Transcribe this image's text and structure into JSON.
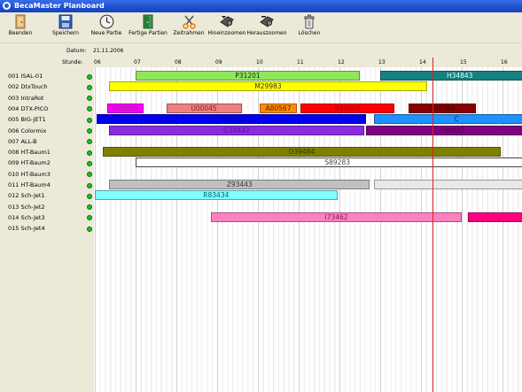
{
  "window": {
    "title": "BecaMaster Planboard"
  },
  "toolbar": {
    "buttons": [
      {
        "label": "Beenden"
      },
      {
        "label": "Speichern"
      },
      {
        "label": "Neue Partie"
      },
      {
        "label": "Fertige Partien"
      },
      {
        "label": "Zeitrahmen"
      },
      {
        "label": "Hineinzoomen"
      },
      {
        "label": "Herauszoomen"
      },
      {
        "label": "Löschen"
      }
    ]
  },
  "header": {
    "datum_label": "Datum:",
    "datum_value": "21.11.2006",
    "stunde_label": "Stunde:",
    "hours": [
      "06",
      "07",
      "08",
      "09",
      "10",
      "11",
      "12",
      "13",
      "14",
      "15",
      "16"
    ]
  },
  "machines": [
    {
      "label": "001  ISAL-01"
    },
    {
      "label": "002  DtxTouch"
    },
    {
      "label": "003  IntraRot"
    },
    {
      "label": "004  DTX-PICO"
    },
    {
      "label": "005  BIG-JET1"
    },
    {
      "label": "006  Colormix"
    },
    {
      "label": "007  ALL-B"
    },
    {
      "label": "008  HT-Baum1"
    },
    {
      "label": "009  HT-Baum2"
    },
    {
      "label": "010  HT-Baum3"
    },
    {
      "label": "011  HT-Baum4"
    },
    {
      "label": "012  Sch-Jet1"
    },
    {
      "label": "013  Sch-Jet2"
    },
    {
      "label": "014  Sch-Jet3"
    },
    {
      "label": "015  Sch-Jet4"
    }
  ],
  "jobs": [
    {
      "id": "job-p31201",
      "label": "P31201",
      "row": 0,
      "start": 7.0,
      "end": 12.5,
      "color": "#8ee85a",
      "text_color": "#222222"
    },
    {
      "id": "job-h34843",
      "label": "H34843",
      "row": 0,
      "start": 13.0,
      "end": 16.9,
      "color": "#178080",
      "text_color": "#e0ffff"
    },
    {
      "id": "job-m29983",
      "label": "M29983",
      "row": 1,
      "start": 6.35,
      "end": 14.15,
      "color": "#ffff00",
      "text_color": "#333333"
    },
    {
      "id": "job-r00005",
      "label": "R00005",
      "row": 3,
      "start": 6.3,
      "end": 7.2,
      "color": "#ff00ff",
      "text_color": "#a0208a"
    },
    {
      "id": "job-u00045",
      "label": "U00045",
      "row": 3,
      "start": 7.75,
      "end": 9.6,
      "color": "#f08080",
      "text_color": "#882020"
    },
    {
      "id": "job-a80567",
      "label": "A80567",
      "row": 3,
      "start": 10.05,
      "end": 10.95,
      "color": "#ff8c00",
      "text_color": "#552200"
    },
    {
      "id": "job-r84008",
      "label": "R84008",
      "row": 3,
      "start": 11.05,
      "end": 13.35,
      "color": "#ff0000",
      "text_color": "#aa0000"
    },
    {
      "id": "job-a09089",
      "label": "A09089",
      "row": 3,
      "start": 13.7,
      "end": 15.35,
      "color": "#8b0000",
      "text_color": "#400000"
    },
    {
      "id": "job-v06213",
      "label": "V06213",
      "row": 4,
      "start": 6.05,
      "end": 12.65,
      "color": "#0000ee",
      "text_color": "#0000aa"
    },
    {
      "id": "job-c00000",
      "label": "C",
      "row": 4,
      "start": 12.85,
      "end": 16.9,
      "color": "#1e90ff",
      "text_color": "#003366"
    },
    {
      "id": "job-g38442",
      "label": "G38442",
      "row": 5,
      "start": 6.35,
      "end": 12.6,
      "color": "#8a2be2",
      "text_color": "#5a10a0"
    },
    {
      "id": "job-f98403",
      "label": "F98403",
      "row": 5,
      "start": 12.65,
      "end": 16.9,
      "color": "#800080",
      "text_color": "#500050"
    },
    {
      "id": "job-o39484",
      "label": "O39484",
      "row": 7,
      "start": 6.2,
      "end": 15.95,
      "color": "#808000",
      "text_color": "#333300"
    },
    {
      "id": "job-s89283",
      "label": "S89283",
      "row": 8,
      "start": 7.0,
      "end": 16.9,
      "color": "#ffffff",
      "text_color": "#444444"
    },
    {
      "id": "job-z93443",
      "label": "Z93443",
      "row": 10,
      "start": 6.35,
      "end": 12.75,
      "color": "#c0c0c0",
      "text_color": "#333333"
    },
    {
      "id": "job-z-cont",
      "label": "",
      "row": 10,
      "start": 12.85,
      "end": 16.9,
      "color": "#e8e8e8",
      "text_color": "#333333"
    },
    {
      "id": "job-r83434",
      "label": "R83434",
      "row": 11,
      "start": 6.0,
      "end": 11.95,
      "color": "#80ffff",
      "text_color": "#006666"
    },
    {
      "id": "job-i73462",
      "label": "I73462",
      "row": 13,
      "start": 8.85,
      "end": 15.0,
      "color": "#ff80c0",
      "text_color": "#802050"
    },
    {
      "id": "job-pink-cont",
      "label": "",
      "row": 13,
      "start": 15.15,
      "end": 16.9,
      "color": "#ff0080",
      "text_color": "#ffffff"
    }
  ],
  "now_hour": 14.3
}
